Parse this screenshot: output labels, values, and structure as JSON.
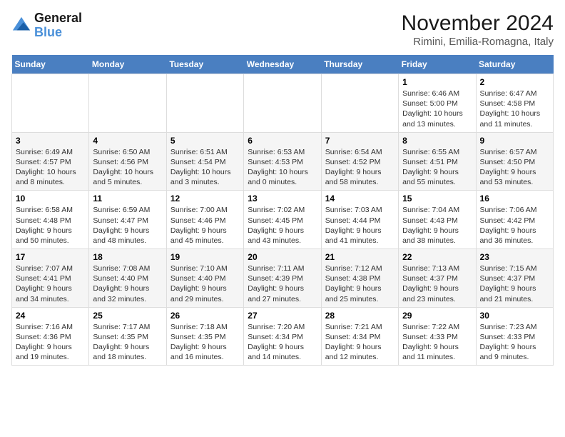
{
  "logo": {
    "line1": "General",
    "line2": "Blue"
  },
  "title": {
    "month": "November 2024",
    "location": "Rimini, Emilia-Romagna, Italy"
  },
  "days_of_week": [
    "Sunday",
    "Monday",
    "Tuesday",
    "Wednesday",
    "Thursday",
    "Friday",
    "Saturday"
  ],
  "weeks": [
    [
      {
        "day": "",
        "sunrise": "",
        "sunset": "",
        "daylight": ""
      },
      {
        "day": "",
        "sunrise": "",
        "sunset": "",
        "daylight": ""
      },
      {
        "day": "",
        "sunrise": "",
        "sunset": "",
        "daylight": ""
      },
      {
        "day": "",
        "sunrise": "",
        "sunset": "",
        "daylight": ""
      },
      {
        "day": "",
        "sunrise": "",
        "sunset": "",
        "daylight": ""
      },
      {
        "day": "1",
        "sunrise": "Sunrise: 6:46 AM",
        "sunset": "Sunset: 5:00 PM",
        "daylight": "Daylight: 10 hours and 13 minutes."
      },
      {
        "day": "2",
        "sunrise": "Sunrise: 6:47 AM",
        "sunset": "Sunset: 4:58 PM",
        "daylight": "Daylight: 10 hours and 11 minutes."
      }
    ],
    [
      {
        "day": "3",
        "sunrise": "Sunrise: 6:49 AM",
        "sunset": "Sunset: 4:57 PM",
        "daylight": "Daylight: 10 hours and 8 minutes."
      },
      {
        "day": "4",
        "sunrise": "Sunrise: 6:50 AM",
        "sunset": "Sunset: 4:56 PM",
        "daylight": "Daylight: 10 hours and 5 minutes."
      },
      {
        "day": "5",
        "sunrise": "Sunrise: 6:51 AM",
        "sunset": "Sunset: 4:54 PM",
        "daylight": "Daylight: 10 hours and 3 minutes."
      },
      {
        "day": "6",
        "sunrise": "Sunrise: 6:53 AM",
        "sunset": "Sunset: 4:53 PM",
        "daylight": "Daylight: 10 hours and 0 minutes."
      },
      {
        "day": "7",
        "sunrise": "Sunrise: 6:54 AM",
        "sunset": "Sunset: 4:52 PM",
        "daylight": "Daylight: 9 hours and 58 minutes."
      },
      {
        "day": "8",
        "sunrise": "Sunrise: 6:55 AM",
        "sunset": "Sunset: 4:51 PM",
        "daylight": "Daylight: 9 hours and 55 minutes."
      },
      {
        "day": "9",
        "sunrise": "Sunrise: 6:57 AM",
        "sunset": "Sunset: 4:50 PM",
        "daylight": "Daylight: 9 hours and 53 minutes."
      }
    ],
    [
      {
        "day": "10",
        "sunrise": "Sunrise: 6:58 AM",
        "sunset": "Sunset: 4:48 PM",
        "daylight": "Daylight: 9 hours and 50 minutes."
      },
      {
        "day": "11",
        "sunrise": "Sunrise: 6:59 AM",
        "sunset": "Sunset: 4:47 PM",
        "daylight": "Daylight: 9 hours and 48 minutes."
      },
      {
        "day": "12",
        "sunrise": "Sunrise: 7:00 AM",
        "sunset": "Sunset: 4:46 PM",
        "daylight": "Daylight: 9 hours and 45 minutes."
      },
      {
        "day": "13",
        "sunrise": "Sunrise: 7:02 AM",
        "sunset": "Sunset: 4:45 PM",
        "daylight": "Daylight: 9 hours and 43 minutes."
      },
      {
        "day": "14",
        "sunrise": "Sunrise: 7:03 AM",
        "sunset": "Sunset: 4:44 PM",
        "daylight": "Daylight: 9 hours and 41 minutes."
      },
      {
        "day": "15",
        "sunrise": "Sunrise: 7:04 AM",
        "sunset": "Sunset: 4:43 PM",
        "daylight": "Daylight: 9 hours and 38 minutes."
      },
      {
        "day": "16",
        "sunrise": "Sunrise: 7:06 AM",
        "sunset": "Sunset: 4:42 PM",
        "daylight": "Daylight: 9 hours and 36 minutes."
      }
    ],
    [
      {
        "day": "17",
        "sunrise": "Sunrise: 7:07 AM",
        "sunset": "Sunset: 4:41 PM",
        "daylight": "Daylight: 9 hours and 34 minutes."
      },
      {
        "day": "18",
        "sunrise": "Sunrise: 7:08 AM",
        "sunset": "Sunset: 4:40 PM",
        "daylight": "Daylight: 9 hours and 32 minutes."
      },
      {
        "day": "19",
        "sunrise": "Sunrise: 7:10 AM",
        "sunset": "Sunset: 4:40 PM",
        "daylight": "Daylight: 9 hours and 29 minutes."
      },
      {
        "day": "20",
        "sunrise": "Sunrise: 7:11 AM",
        "sunset": "Sunset: 4:39 PM",
        "daylight": "Daylight: 9 hours and 27 minutes."
      },
      {
        "day": "21",
        "sunrise": "Sunrise: 7:12 AM",
        "sunset": "Sunset: 4:38 PM",
        "daylight": "Daylight: 9 hours and 25 minutes."
      },
      {
        "day": "22",
        "sunrise": "Sunrise: 7:13 AM",
        "sunset": "Sunset: 4:37 PM",
        "daylight": "Daylight: 9 hours and 23 minutes."
      },
      {
        "day": "23",
        "sunrise": "Sunrise: 7:15 AM",
        "sunset": "Sunset: 4:37 PM",
        "daylight": "Daylight: 9 hours and 21 minutes."
      }
    ],
    [
      {
        "day": "24",
        "sunrise": "Sunrise: 7:16 AM",
        "sunset": "Sunset: 4:36 PM",
        "daylight": "Daylight: 9 hours and 19 minutes."
      },
      {
        "day": "25",
        "sunrise": "Sunrise: 7:17 AM",
        "sunset": "Sunset: 4:35 PM",
        "daylight": "Daylight: 9 hours and 18 minutes."
      },
      {
        "day": "26",
        "sunrise": "Sunrise: 7:18 AM",
        "sunset": "Sunset: 4:35 PM",
        "daylight": "Daylight: 9 hours and 16 minutes."
      },
      {
        "day": "27",
        "sunrise": "Sunrise: 7:20 AM",
        "sunset": "Sunset: 4:34 PM",
        "daylight": "Daylight: 9 hours and 14 minutes."
      },
      {
        "day": "28",
        "sunrise": "Sunrise: 7:21 AM",
        "sunset": "Sunset: 4:34 PM",
        "daylight": "Daylight: 9 hours and 12 minutes."
      },
      {
        "day": "29",
        "sunrise": "Sunrise: 7:22 AM",
        "sunset": "Sunset: 4:33 PM",
        "daylight": "Daylight: 9 hours and 11 minutes."
      },
      {
        "day": "30",
        "sunrise": "Sunrise: 7:23 AM",
        "sunset": "Sunset: 4:33 PM",
        "daylight": "Daylight: 9 hours and 9 minutes."
      }
    ]
  ]
}
